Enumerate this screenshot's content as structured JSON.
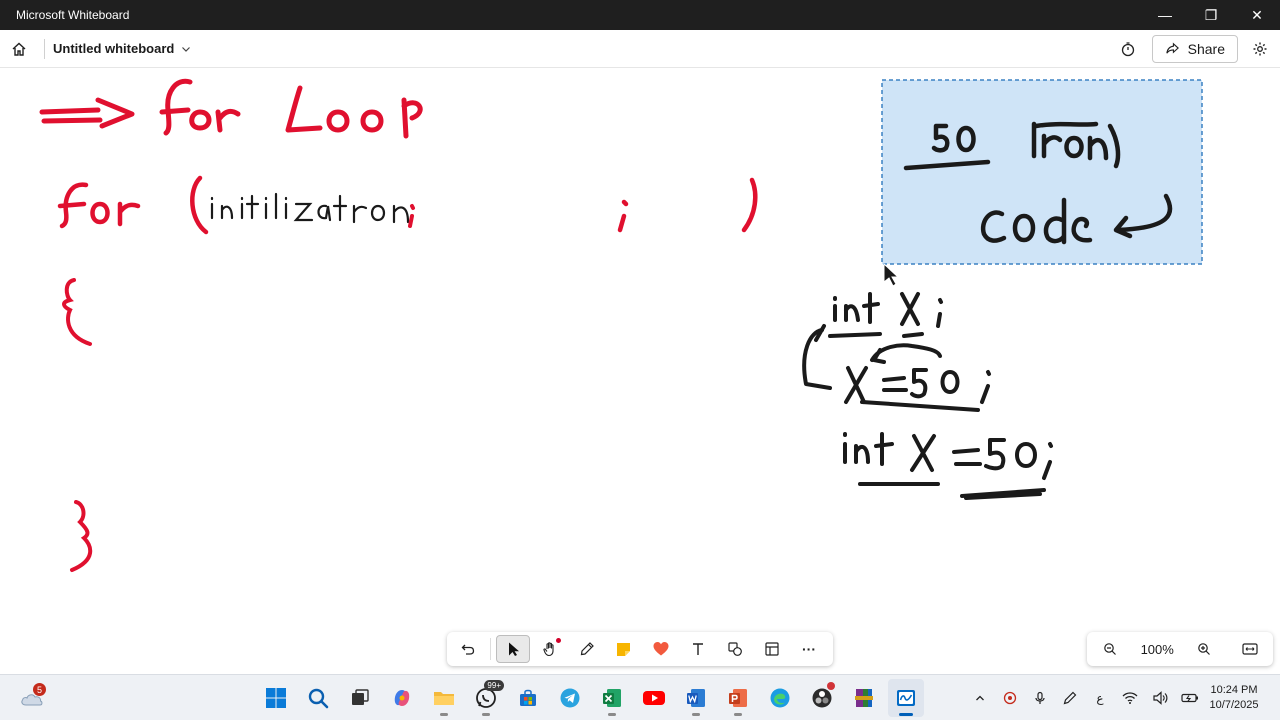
{
  "window": {
    "title": "Microsoft Whiteboard",
    "controls": {
      "minimize": "—",
      "restore": "❐",
      "close": "✕"
    }
  },
  "header": {
    "document_title": "Untitled whiteboard",
    "share_label": "Share"
  },
  "canvas": {
    "sticky_note_color": "#cfe4f7",
    "ink_colors": {
      "red": "#e0102f",
      "black": "#1a1a1a"
    }
  },
  "toolbar": {
    "tools": [
      "undo-icon",
      "select-icon",
      "hand-icon",
      "pen-icon",
      "sticky-note-icon",
      "reaction-icon",
      "text-icon",
      "shapes-icon",
      "templates-icon",
      "more-icon"
    ],
    "more_label": "···"
  },
  "zoom": {
    "level": "100%"
  },
  "taskbar": {
    "weather_badge": "5",
    "whatsapp_badge": "99+",
    "clock_time": "10:24 PM",
    "clock_date": "10/7/2025",
    "language": "ع"
  }
}
